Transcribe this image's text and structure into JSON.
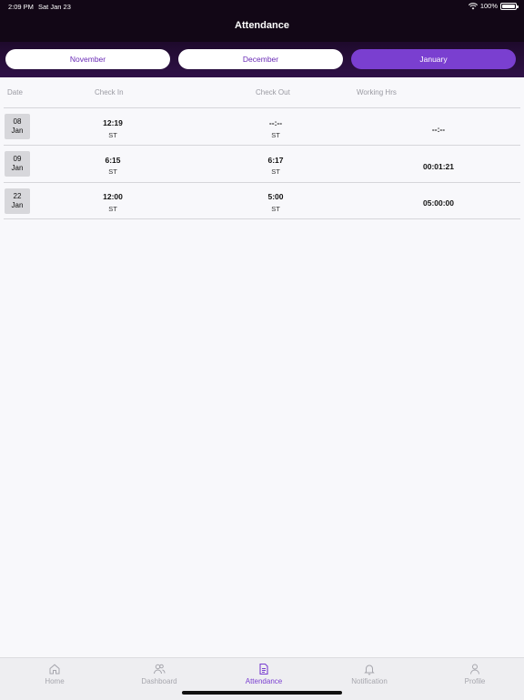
{
  "status_bar": {
    "time": "2:09 PM",
    "date": "Sat Jan 23",
    "battery": "100%"
  },
  "header": {
    "title": "Attendance"
  },
  "months": [
    {
      "label": "November",
      "active": false
    },
    {
      "label": "December",
      "active": false
    },
    {
      "label": "January",
      "active": true
    }
  ],
  "table": {
    "columns": [
      "Date",
      "Check In",
      "Check Out",
      "Working Hrs"
    ],
    "rows": [
      {
        "day": "08",
        "month": "Jan",
        "check_in": "12:19",
        "check_in_zone": "ST",
        "check_out": "--:--",
        "check_out_zone": "ST",
        "working_hrs": "--:--"
      },
      {
        "day": "09",
        "month": "Jan",
        "check_in": "6:15",
        "check_in_zone": "ST",
        "check_out": "6:17",
        "check_out_zone": "ST",
        "working_hrs": "00:01:21"
      },
      {
        "day": "22",
        "month": "Jan",
        "check_in": "12:00",
        "check_in_zone": "ST",
        "check_out": "5:00",
        "check_out_zone": "ST",
        "working_hrs": "05:00:00"
      }
    ]
  },
  "tabbar": {
    "items": [
      {
        "label": "Home",
        "icon": "home-icon"
      },
      {
        "label": "Dashboard",
        "icon": "users-icon"
      },
      {
        "label": "Attendance",
        "icon": "document-icon",
        "active": true
      },
      {
        "label": "Notification",
        "icon": "bell-icon"
      },
      {
        "label": "Profile",
        "icon": "user-icon"
      }
    ]
  },
  "colors": {
    "accent": "#7a3fd0",
    "header_bg": "#120716"
  }
}
